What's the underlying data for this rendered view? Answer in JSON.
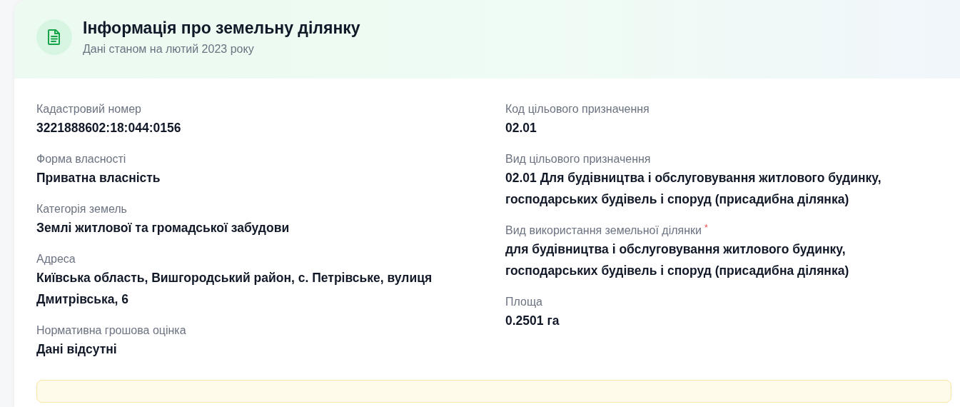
{
  "header": {
    "title": "Інформація про земельну ділянку",
    "subtitle": "Дані станом на лютий 2023 року"
  },
  "columns": [
    {
      "fields": [
        {
          "label": "Кадастровий номер",
          "value": "3221888602:18:044:0156"
        },
        {
          "label": "Форма власності",
          "value": "Приватна власність"
        },
        {
          "label": "Категорія земель",
          "value": "Землі житлової та громадської забудови"
        },
        {
          "label": "Адреса",
          "value": "Київська область, Вишгородський район, с. Петрівське, вулиця Дмитрівська, 6"
        },
        {
          "label": "Нормативна грошова оцінка",
          "value": "Дані відсутні"
        }
      ]
    },
    {
      "fields": [
        {
          "label": "Код цільового призначення",
          "value": "02.01"
        },
        {
          "label": "Вид цільового призначення",
          "value": "02.01 Для будівництва і обслуговування житлового будинку, господарських будівель і споруд (присадибна ділянка)"
        },
        {
          "label": "Вид використання земельної ділянки",
          "required_mark": "*",
          "value": "для будівництва і обслуговування житлового будинку, господарських будівель і споруд (присадибна ділянка)"
        },
        {
          "label": "Площа",
          "value": "0.2501 га"
        }
      ]
    }
  ]
}
